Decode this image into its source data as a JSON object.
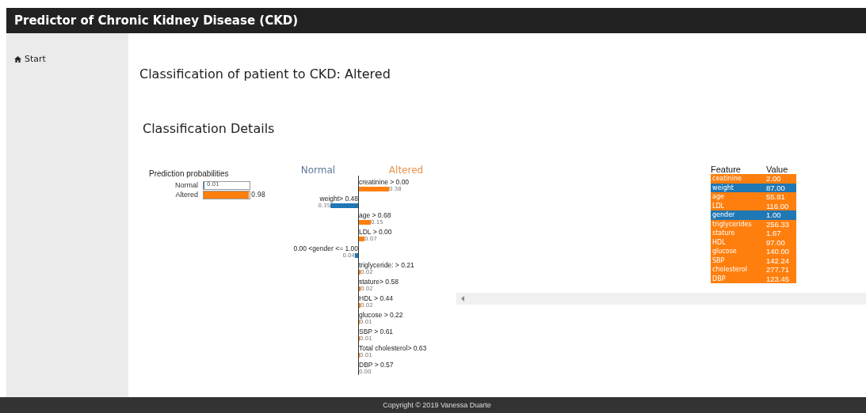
{
  "header": {
    "title": "Predictor of Chronic Kidney Disease (CKD)"
  },
  "sidebar": {
    "items": [
      {
        "label": "Start",
        "selected": false
      }
    ]
  },
  "result": "Classification of patient to CKD: Altered",
  "details_title": "Classification Details",
  "probabilities": {
    "title": "Prediction probabilities",
    "items": [
      {
        "label": "Normal",
        "value": "0.01",
        "level": 0.01,
        "color": "#1f77b4"
      },
      {
        "label": "Altered",
        "value": "0.98",
        "level": 0.98,
        "color": "#ff7f0e"
      }
    ]
  },
  "explanation": {
    "headers": [
      {
        "label": "Normal",
        "color": "#5b7a99"
      },
      {
        "label": "Altered",
        "color": "#e8914a"
      }
    ],
    "features": [
      {
        "label": "creatinine > 0.00",
        "value": "0.38",
        "kind": "altered"
      },
      {
        "label": "weight> 0.48",
        "value": "0.35",
        "kind": "normal"
      },
      {
        "label": "age > 0.68",
        "value": "0.15",
        "kind": "altered"
      },
      {
        "label": "LDL > 0.00",
        "value": "0.07",
        "kind": "altered"
      },
      {
        "label": "0.00 <gender <= 1.00",
        "value": "0.04",
        "kind": "normal"
      },
      {
        "label": "triglyceride: > 0.21",
        "value": "0.02",
        "kind": "altered"
      },
      {
        "label": "stature> 0.58",
        "value": "0.02",
        "kind": "altered"
      },
      {
        "label": "HDL > 0.44",
        "value": "0.02",
        "kind": "altered"
      },
      {
        "label": "glucose > 0.22",
        "value": "0.01",
        "kind": "altered"
      },
      {
        "label": "SBP > 0.61",
        "value": "0.01",
        "kind": "altered"
      },
      {
        "label": "Total cholesterol> 0.63",
        "value": "0.01",
        "kind": "altered"
      },
      {
        "label": "DBP > 0.57",
        "value": "0.00",
        "kind": "altered"
      }
    ]
  },
  "feature_table": {
    "columns": [
      "Feature",
      "Value"
    ],
    "rows": [
      {
        "feature": "ceatinine",
        "value": "2.00",
        "color": "#ff7f0e"
      },
      {
        "feature": "weight",
        "value": "87.00",
        "color": "#1f77b4"
      },
      {
        "feature": "age",
        "value": "55.81",
        "color": "#ff7f0e"
      },
      {
        "feature": "LDL",
        "value": "116.00",
        "color": "#ff7f0e"
      },
      {
        "feature": "gender",
        "value": "1.00",
        "color": "#1f77b4"
      },
      {
        "feature": "triglycerides",
        "value": "256.33",
        "color": "#ff7f0e"
      },
      {
        "feature": "stature",
        "value": "1.67",
        "color": "#ff7f0e"
      },
      {
        "feature": "HDL",
        "value": "97.00",
        "color": "#ff7f0e"
      },
      {
        "feature": "glucose",
        "value": "140.00",
        "color": "#ff7f0e"
      },
      {
        "feature": "SBP",
        "value": "142.24",
        "color": "#ff7f0e"
      },
      {
        "feature": "cholesterol",
        "value": "277.71",
        "color": "#ff7f0e"
      },
      {
        "feature": "DBP",
        "value": "123.45",
        "color": "#ff7f0e"
      }
    ]
  },
  "footer": "Copyright © 2019 Vanessa Duarte"
}
